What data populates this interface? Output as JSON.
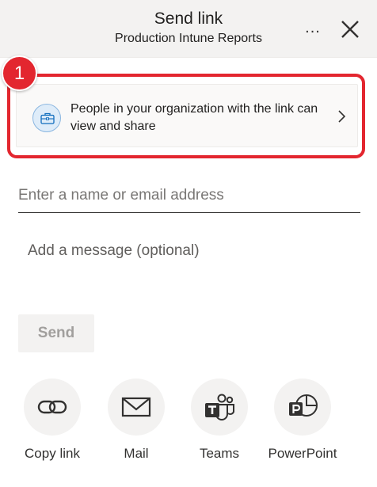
{
  "header": {
    "title": "Send link",
    "subtitle": "Production Intune Reports",
    "more_label": "...",
    "close_icon": "close-icon"
  },
  "callout": {
    "number": "1",
    "color": "#e3262f"
  },
  "link_setting": {
    "text": "People in your organization with the link can view and share",
    "icon": "briefcase-icon"
  },
  "recipient": {
    "placeholder": "Enter a name or email address",
    "value": ""
  },
  "message": {
    "placeholder": "Add a message (optional)",
    "value": ""
  },
  "send": {
    "label": "Send",
    "enabled": false
  },
  "share_options": [
    {
      "label": "Copy link",
      "icon": "link-icon"
    },
    {
      "label": "Mail",
      "icon": "mail-icon"
    },
    {
      "label": "Teams",
      "icon": "teams-icon"
    },
    {
      "label": "PowerPoint",
      "icon": "powerpoint-icon"
    }
  ]
}
